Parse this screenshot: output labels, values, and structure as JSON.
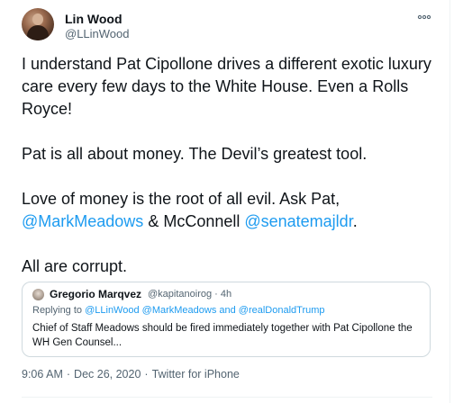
{
  "tweet": {
    "author": {
      "name": "Lin Wood",
      "handle": "@LLinWood"
    },
    "more_icon": "more-dots-icon",
    "paragraphs": {
      "p1": "I understand Pat Cipollone drives a different exotic luxury care every few days to the White House. Even a Rolls Royce!",
      "p2": "Pat is all about money. The Devil’s greatest tool.",
      "p3_pre": "Love of money is the root of all evil. Ask Pat, ",
      "p3_mention1": "@MarkMeadows",
      "p3_mid": " & McConnell ",
      "p3_mention2": "@senatemajldr",
      "p3_post": ".",
      "p4": "All are corrupt."
    },
    "quoted": {
      "name": "Gregorio Marqvez",
      "handle_time": "@kapitanoirog · 4h",
      "replying_label": "Replying to ",
      "replying_to": "@LLinWood @MarkMeadows and @realDonaldTrump",
      "text": "Chief of Staff Meadows should be fired immediately together with  Pat Cipollone the WH Gen Counsel..."
    },
    "footer": {
      "time": "9:06 AM",
      "date": "Dec 26, 2020",
      "source": "Twitter for iPhone"
    }
  },
  "colors": {
    "link": "#1d9bf0",
    "secondary_text": "#536471",
    "primary_text": "#0f1419"
  }
}
